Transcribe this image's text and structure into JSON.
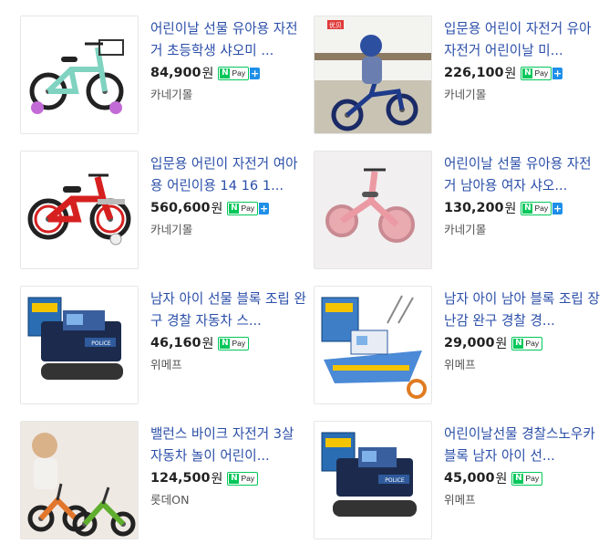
{
  "products": [
    {
      "title": "어린이날 선물 유아용 자전거 초등학생 샤오미 ...",
      "price": "84,900",
      "won": "원",
      "npay_text": "Pay",
      "plus": true,
      "store": "카네기몰",
      "thumb_icon": "kids-bicycle-mint-icon",
      "corner_badge": ""
    },
    {
      "title": "입문용 어린이 자전거 유아자전거 어린이날 미...",
      "price": "226,100",
      "won": "원",
      "npay_text": "Pay",
      "plus": true,
      "store": "카네기몰",
      "thumb_icon": "child-riding-bicycle-icon",
      "corner_badge": "优贝"
    },
    {
      "title": "입문용 어린이 자전거 여아용 어린이용 14 16 1...",
      "price": "560,600",
      "won": "원",
      "npay_text": "Pay",
      "plus": true,
      "store": "카네기몰",
      "thumb_icon": "kids-bicycle-red-icon",
      "corner_badge": ""
    },
    {
      "title": "어린이날 선물 유아용 자전거 남아용 여자 샤오...",
      "price": "130,200",
      "won": "원",
      "npay_text": "Pay",
      "plus": true,
      "store": "카네기몰",
      "thumb_icon": "balance-tricycle-pink-icon",
      "corner_badge": ""
    },
    {
      "title": "남자 아이 선물 블록 조립 완구 경찰 자동차 스...",
      "price": "46,160",
      "won": "원",
      "npay_text": "Pay",
      "plus": false,
      "store": "위메프",
      "thumb_icon": "police-truck-blocks-icon",
      "corner_badge": ""
    },
    {
      "title": "남자 아이 남아 블록 조립 장난감 완구 경찰 경...",
      "price": "29,000",
      "won": "원",
      "npay_text": "Pay",
      "plus": false,
      "store": "위메프",
      "thumb_icon": "police-boat-blocks-icon",
      "corner_badge": ""
    },
    {
      "title": "밸런스 바이크 자전거 3살 자동차 놀이 어린이...",
      "price": "124,500",
      "won": "원",
      "npay_text": "Pay",
      "plus": false,
      "store": "롯데ON",
      "thumb_icon": "balance-bikes-child-icon",
      "corner_badge": ""
    },
    {
      "title": "어린이날선물 경찰스노우카블록 남자 아이 선...",
      "price": "45,000",
      "won": "원",
      "npay_text": "Pay",
      "plus": false,
      "store": "위메프",
      "thumb_icon": "police-snow-truck-blocks-icon",
      "corner_badge": ""
    }
  ],
  "colors": {
    "title": "#2a4ea8",
    "npay_green": "#03c75a",
    "npay_plus": "#1e8fe8"
  }
}
